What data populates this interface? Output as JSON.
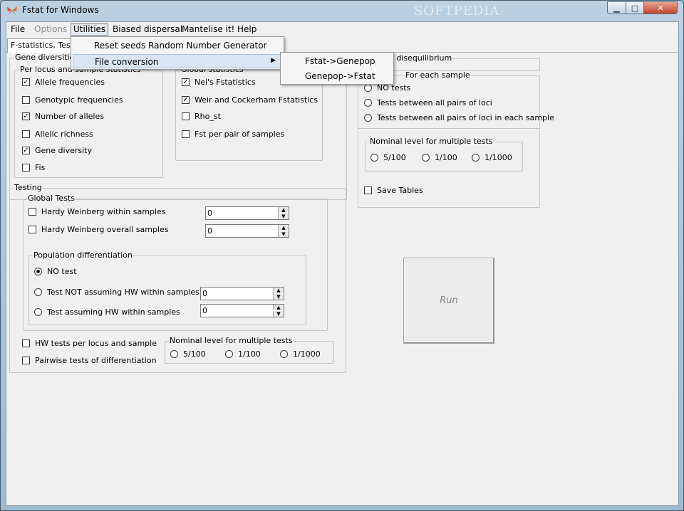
{
  "window": {
    "title": "Fstat for Windows",
    "watermark": "SOFTPEDIA",
    "min_glyph": "▁",
    "max_glyph": "□",
    "close_glyph": "✕"
  },
  "menu": {
    "items": [
      "File",
      "Options",
      "Utilities",
      "Biased dispersal",
      "Mantelise it!",
      "Help"
    ],
    "disabled": [
      "Options"
    ],
    "active": "Utilities"
  },
  "utilities_menu": {
    "items": [
      "Reset seeds Random Number Generator",
      "File conversion"
    ],
    "submenu_arrow": "▶"
  },
  "file_conversion_submenu": {
    "items": [
      "Fstat->Genepop",
      "Genepop->Fstat"
    ]
  },
  "tab": {
    "label": "F-statistics, Testing"
  },
  "gene_diversities": {
    "title": "Gene diversities",
    "per_locus": {
      "title": "Per locus and sample statistics",
      "items": [
        {
          "label": "Allele frequencies",
          "checked": true
        },
        {
          "label": "Genotypic frequencies",
          "checked": false
        },
        {
          "label": "Number of alleles",
          "checked": true
        },
        {
          "label": "Allelic richness",
          "checked": false
        },
        {
          "label": "Gene diversity",
          "checked": true
        },
        {
          "label": "Fis",
          "checked": false
        }
      ]
    },
    "global": {
      "title": "Global statistics",
      "items": [
        {
          "label": "Nei's Fstatistics",
          "checked": true
        },
        {
          "label": "Weir and Cockerham Fstatistics",
          "checked": true
        },
        {
          "label": "Rho_st",
          "checked": false
        },
        {
          "label": "Fst per pair of samples",
          "checked": false
        }
      ]
    }
  },
  "linkage": {
    "title": "Linkage disequilibrium",
    "subtitle": "For each sample",
    "radios": [
      {
        "label": "NO tests",
        "checked": false
      },
      {
        "label": "Tests between all pairs of loci",
        "checked": false
      },
      {
        "label": "Tests between all pairs of loci in each sample",
        "checked": false
      }
    ],
    "nominal": {
      "title": "Nominal level for multiple tests",
      "options": [
        "5/100",
        "1/100",
        "1/1000"
      ]
    },
    "save_tables": "Save Tables"
  },
  "testing": {
    "title": "Testing",
    "global_tests": {
      "title": "Global Tests",
      "items": [
        {
          "label": "Hardy Weinberg within samples",
          "value": "0"
        },
        {
          "label": "Hardy Weinberg overall samples",
          "value": "0"
        }
      ]
    },
    "pop_diff": {
      "title": "Population differentiation",
      "radios": [
        {
          "label": "NO test",
          "checked": true
        },
        {
          "label": "Test NOT assuming HW within samples",
          "checked": false,
          "value": "0"
        },
        {
          "label": "Test assuming HW within samples",
          "checked": false,
          "value": "0"
        }
      ]
    },
    "hw_per_locus": "HW tests per locus and sample",
    "pairwise": "Pairwise tests of differentiation",
    "nominal": {
      "title": "Nominal level for multiple tests",
      "options": [
        "5/100",
        "1/100",
        "1/1000"
      ]
    }
  },
  "run_label": "Run",
  "glyphs": {
    "check": "✓",
    "up": "▲",
    "down": "▼"
  }
}
